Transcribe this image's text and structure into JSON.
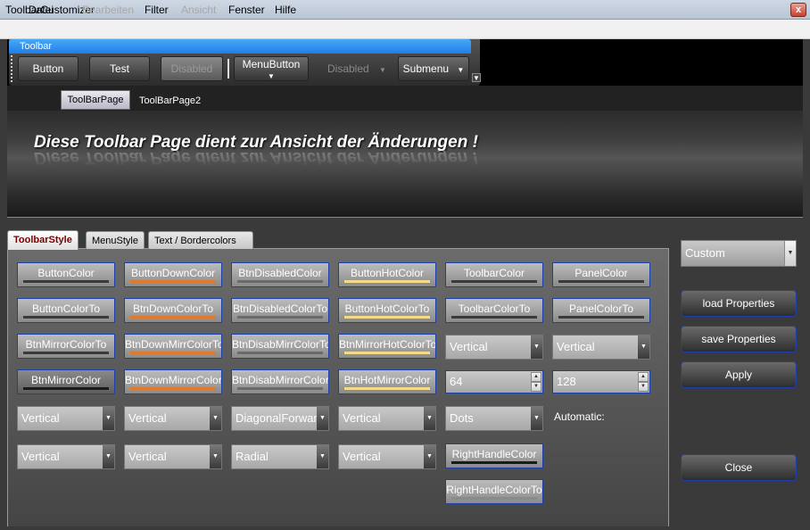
{
  "window": {
    "title": "ToolbarCustomizer",
    "close_glyph": "x"
  },
  "menu": {
    "items": [
      {
        "label": "Datei",
        "enabled": true
      },
      {
        "label": "Bearbeiten",
        "enabled": false
      },
      {
        "label": "Filter",
        "enabled": true
      },
      {
        "label": "Ansicht",
        "enabled": false
      },
      {
        "label": "Fenster",
        "enabled": true
      },
      {
        "label": "Hilfe",
        "enabled": true
      }
    ]
  },
  "toolbar": {
    "caption": "Toolbar",
    "button": "Button",
    "test": "Test",
    "disabled_btn": "Disabled",
    "menubutton": "MenuButton",
    "disabled_dd": "Disabled",
    "submenu": "Submenu",
    "arrow": "▼"
  },
  "pages": {
    "tab1": "ToolBarPage",
    "tab2": "ToolBarPage2",
    "banner": "Diese Toolbar Page dient zur Ansicht der Änderungen !"
  },
  "style_tabs": [
    "ToolbarStyle",
    "MenuStyle",
    "Text / Bordercolors"
  ],
  "grid": {
    "row1": [
      {
        "label": "ButtonColor",
        "bar": "#3a3a3a"
      },
      {
        "label": "ButtonDownColor",
        "bar": "#e07a2a"
      },
      {
        "label": "BtnDisabledColor",
        "bar": "#6a6a6a"
      },
      {
        "label": "ButtonHotColor",
        "bar": "#f2dc8c"
      },
      {
        "label": "ToolbarColor",
        "bar": "#3a3a3a"
      },
      {
        "label": "PanelColor",
        "bar": "#3a3a3a"
      }
    ],
    "row2": [
      {
        "label": "ButtonColorTo",
        "bar": "#3a3a3a"
      },
      {
        "label": "BtnDownColorTo",
        "bar": "#e07a2a"
      },
      {
        "label": "BtnDisabledColorTo",
        "bar": "#6a6a6a"
      },
      {
        "label": "ButtonHotColorTo",
        "bar": "#f2dc8c"
      },
      {
        "label": "ToolbarColorTo",
        "bar": "#3a3a3a"
      },
      {
        "label": "PanelColorTo",
        "bar": "#3a3a3a"
      }
    ],
    "row3": [
      {
        "label": "BtnMirrorColorTo",
        "bar": "#3a3a3a"
      },
      {
        "label": "BtnDownMirrColorTo",
        "bar": "#e07a2a"
      },
      {
        "label": "BtnDisabMirrColorTo",
        "bar": "#6a6a6a"
      },
      {
        "label": "BtnMirrorHotColorTo",
        "bar": "#f2dc8c"
      }
    ],
    "row3_combos": [
      "Vertical",
      "Vertical"
    ],
    "row4": [
      {
        "label": "BtnMirrorColor",
        "bar": "#1a1a1a"
      },
      {
        "label": "BtnDownMirrorColor",
        "bar": "#e07a2a"
      },
      {
        "label": "BtnDisabMirrorColor",
        "bar": "#6a6a6a"
      },
      {
        "label": "BtnHotMirrorColor",
        "bar": "#f2dc8c"
      }
    ],
    "row4_spins": [
      "64",
      "128"
    ],
    "row5_combos": [
      "Vertical",
      "Vertical",
      "DiagonalForward",
      "Vertical",
      "Dots"
    ],
    "automatic_label": "Automatic:",
    "row6_combos": [
      "Vertical",
      "Vertical",
      "Radial",
      "Vertical"
    ],
    "right_handle": {
      "label": "RightHandleColor",
      "bar": "#1a1a1a"
    },
    "right_handle_to": {
      "label": "RightHandleColorTo",
      "bar": "#8a8a8a"
    }
  },
  "right_panel": {
    "preset": "Custom",
    "load": "load Properties",
    "save": "save Properties",
    "apply": "Apply",
    "close": "Close"
  },
  "icons": {
    "dropdown": "▼",
    "spin_up": "▲",
    "spin_down": "▼"
  }
}
